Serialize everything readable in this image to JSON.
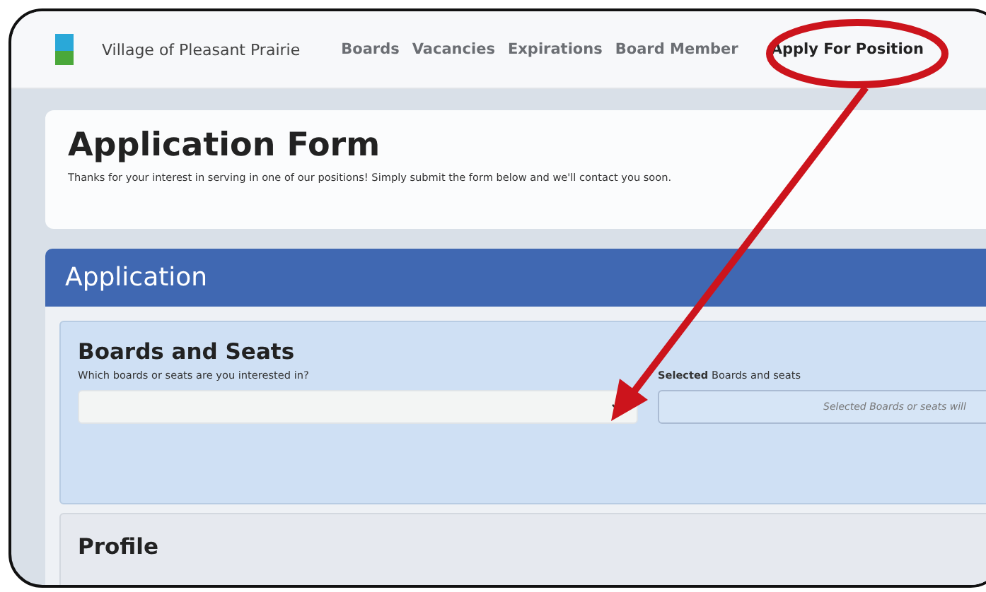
{
  "site": {
    "name": "Village of Pleasant Prairie"
  },
  "nav": [
    {
      "label": "Boards",
      "selected": false
    },
    {
      "label": "Vacancies",
      "selected": false
    },
    {
      "label": "Expirations",
      "selected": false
    },
    {
      "label": "Board Member",
      "selected": false
    },
    {
      "label": "Apply For Position",
      "selected": true
    }
  ],
  "intro": {
    "title": "Application Form",
    "text": "Thanks for your interest in serving in one of our positions! Simply submit the form below and we'll contact you soon."
  },
  "panel": {
    "title": "Application"
  },
  "boards_section": {
    "title": "Boards and Seats",
    "question": "Which boards or seats are you interested in?",
    "selected_label": "**Selected** Boards and seats",
    "selected_placeholder": "Selected Boards or seats will"
  },
  "profile": {
    "title": "Profile"
  }
}
